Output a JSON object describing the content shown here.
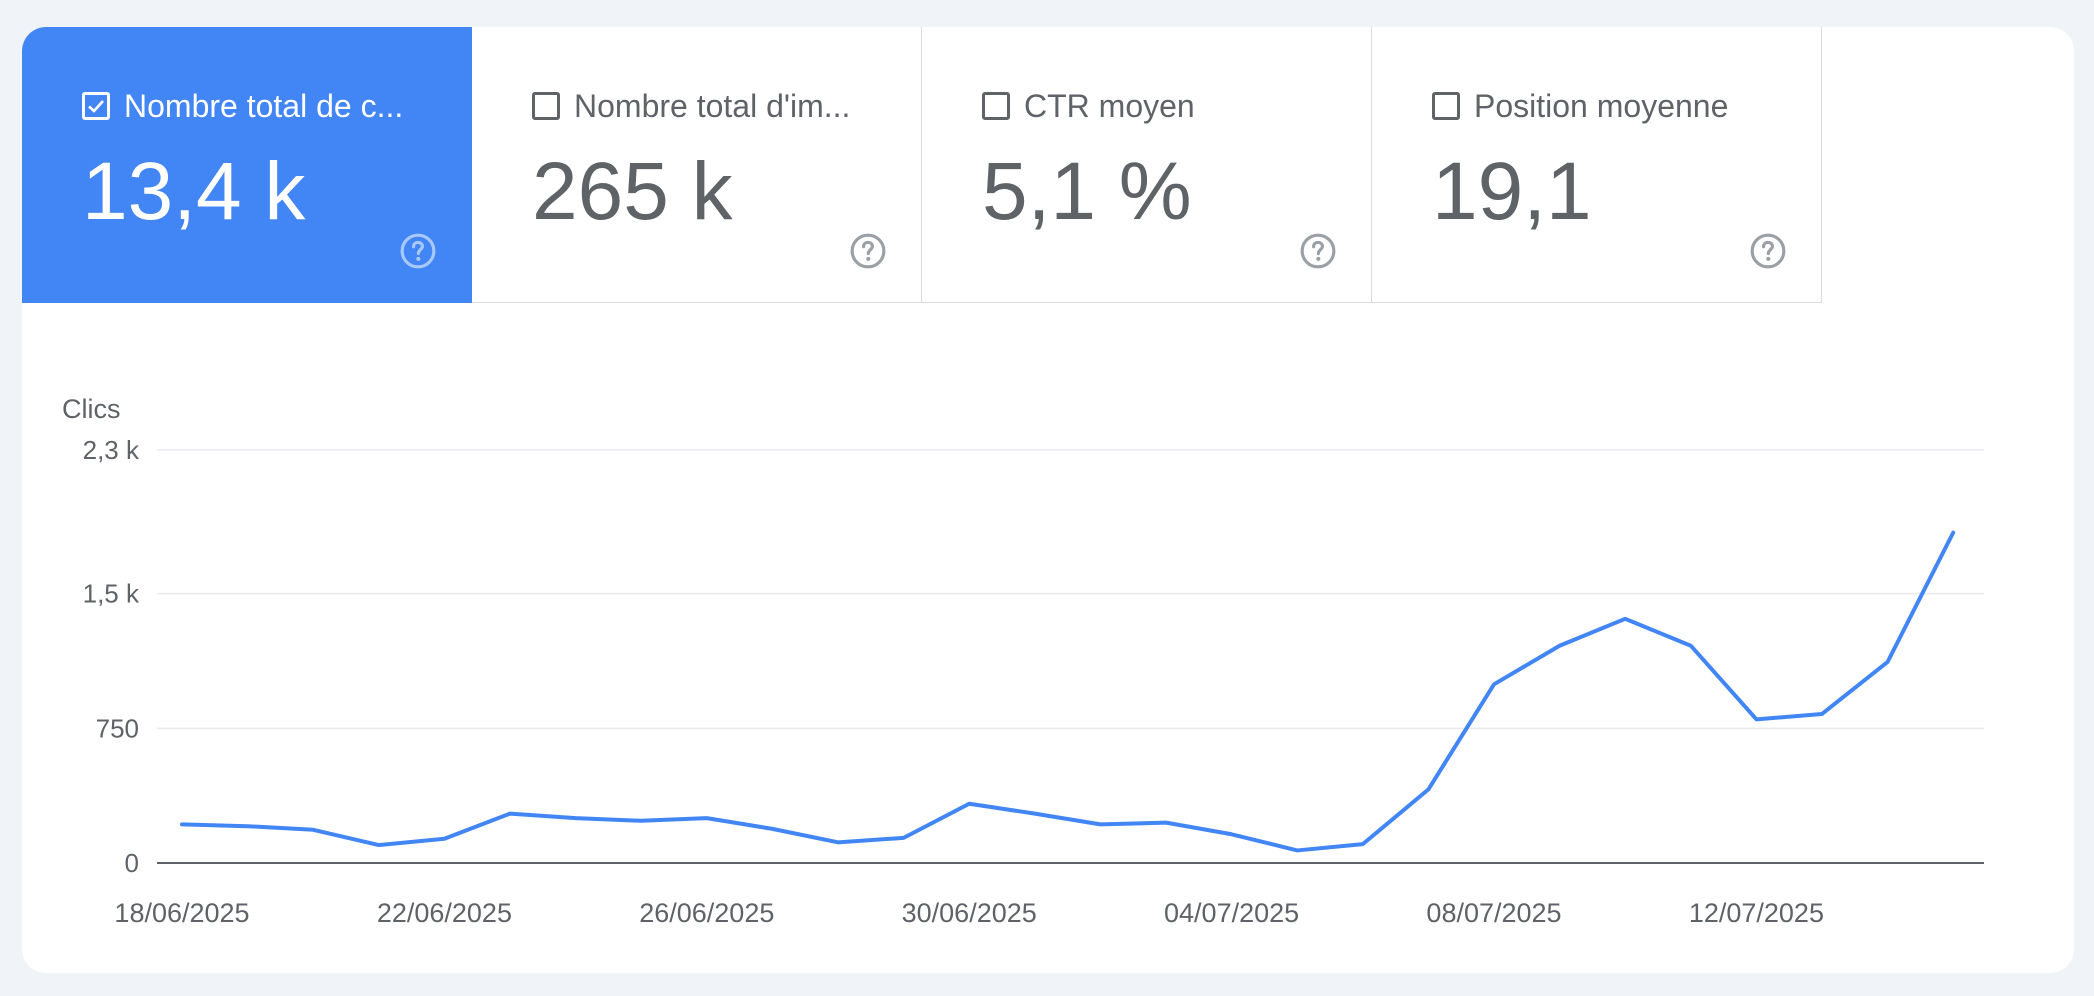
{
  "metrics": [
    {
      "label": "Nombre total de c...",
      "value": "13,4 k",
      "checked": true,
      "icon": "checkbox-checked-icon"
    },
    {
      "label": "Nombre total d'im...",
      "value": "265 k",
      "checked": false,
      "icon": "checkbox-icon"
    },
    {
      "label": "CTR moyen",
      "value": "5,1 %",
      "checked": false,
      "icon": "checkbox-icon"
    },
    {
      "label": "Position moyenne",
      "value": "19,1",
      "checked": false,
      "icon": "checkbox-icon"
    }
  ],
  "colors": {
    "accent": "#4285f4",
    "line": "#4285f4",
    "grid": "#e8eaed",
    "axis": "#5f6368",
    "text": "#5f6368"
  },
  "chart_data": {
    "type": "line",
    "ylabel": "Clics",
    "ylim": [
      0,
      2300
    ],
    "yticks": [
      0,
      750,
      1500,
      2300
    ],
    "ytick_labels": [
      "0",
      "750",
      "1,5 k",
      "2,3 k"
    ],
    "xtick_labels": [
      "18/06/2025",
      "22/06/2025",
      "26/06/2025",
      "30/06/2025",
      "04/07/2025",
      "08/07/2025",
      "12/07/2025"
    ],
    "x": [
      "18/06/2025",
      "19/06/2025",
      "20/06/2025",
      "21/06/2025",
      "22/06/2025",
      "23/06/2025",
      "24/06/2025",
      "25/06/2025",
      "26/06/2025",
      "27/06/2025",
      "28/06/2025",
      "29/06/2025",
      "30/06/2025",
      "01/07/2025",
      "02/07/2025",
      "03/07/2025",
      "04/07/2025",
      "05/07/2025",
      "06/07/2025",
      "07/07/2025",
      "08/07/2025",
      "09/07/2025",
      "10/07/2025",
      "11/07/2025",
      "12/07/2025",
      "13/07/2025",
      "14/07/2025",
      "15/07/2025"
    ],
    "series": [
      {
        "name": "Clics",
        "values": [
          215,
          205,
          185,
          100,
          135,
          275,
          250,
          235,
          250,
          190,
          115,
          140,
          330,
          275,
          215,
          225,
          160,
          70,
          105,
          410,
          995,
          1210,
          1360,
          1210,
          800,
          830,
          1120,
          1840
        ]
      }
    ],
    "grid": true
  }
}
